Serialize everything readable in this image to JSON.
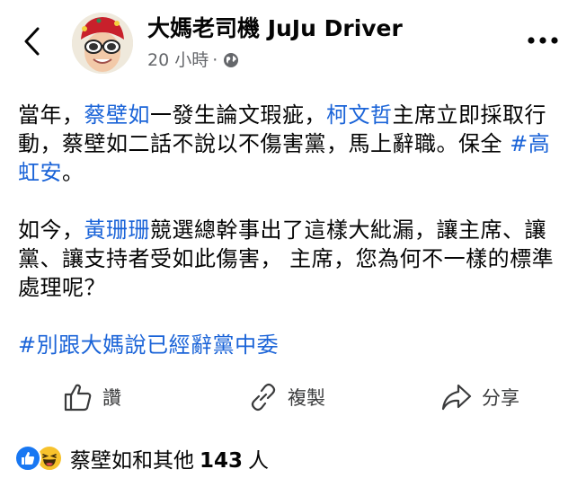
{
  "header": {
    "author_name": "大媽老司機 JuJu Driver",
    "time": "20 小時",
    "separator": "·",
    "privacy_icon": "globe-icon",
    "back_icon": "chevron-left-icon",
    "more_icon": "more-horizontal-icon"
  },
  "post": {
    "p1": {
      "s1": "當年，",
      "m1": "蔡壁如",
      "s2": "一發生論文瑕疵，",
      "m2": "柯文哲",
      "s3": "主席立即採取行動，蔡壁如二話不說以不傷害黨，馬上辭職。保全 ",
      "h1": "#高虹安",
      "s4": "。"
    },
    "p2": {
      "s1": "如今，",
      "m1": "黃珊珊",
      "s2": "競選總幹事出了這樣大紕漏，讓主席、讓黨、讓支持者受如此傷害，  主席，您為何不一樣的標準處理呢？"
    },
    "p3": {
      "h1": "#別跟大媽說已經辭黨中委"
    }
  },
  "actions": {
    "like_label": "讚",
    "copy_label": "複製",
    "share_label": "分享",
    "like_icon": "thumbs-up-icon",
    "copy_icon": "link-icon",
    "share_icon": "share-arrow-icon"
  },
  "reactions": {
    "names": "蔡壁如和其他",
    "count": "143",
    "unit": "人",
    "colors": {
      "like": "#1877f2",
      "haha": "#f7c22c",
      "link": "#1b64d8"
    }
  }
}
